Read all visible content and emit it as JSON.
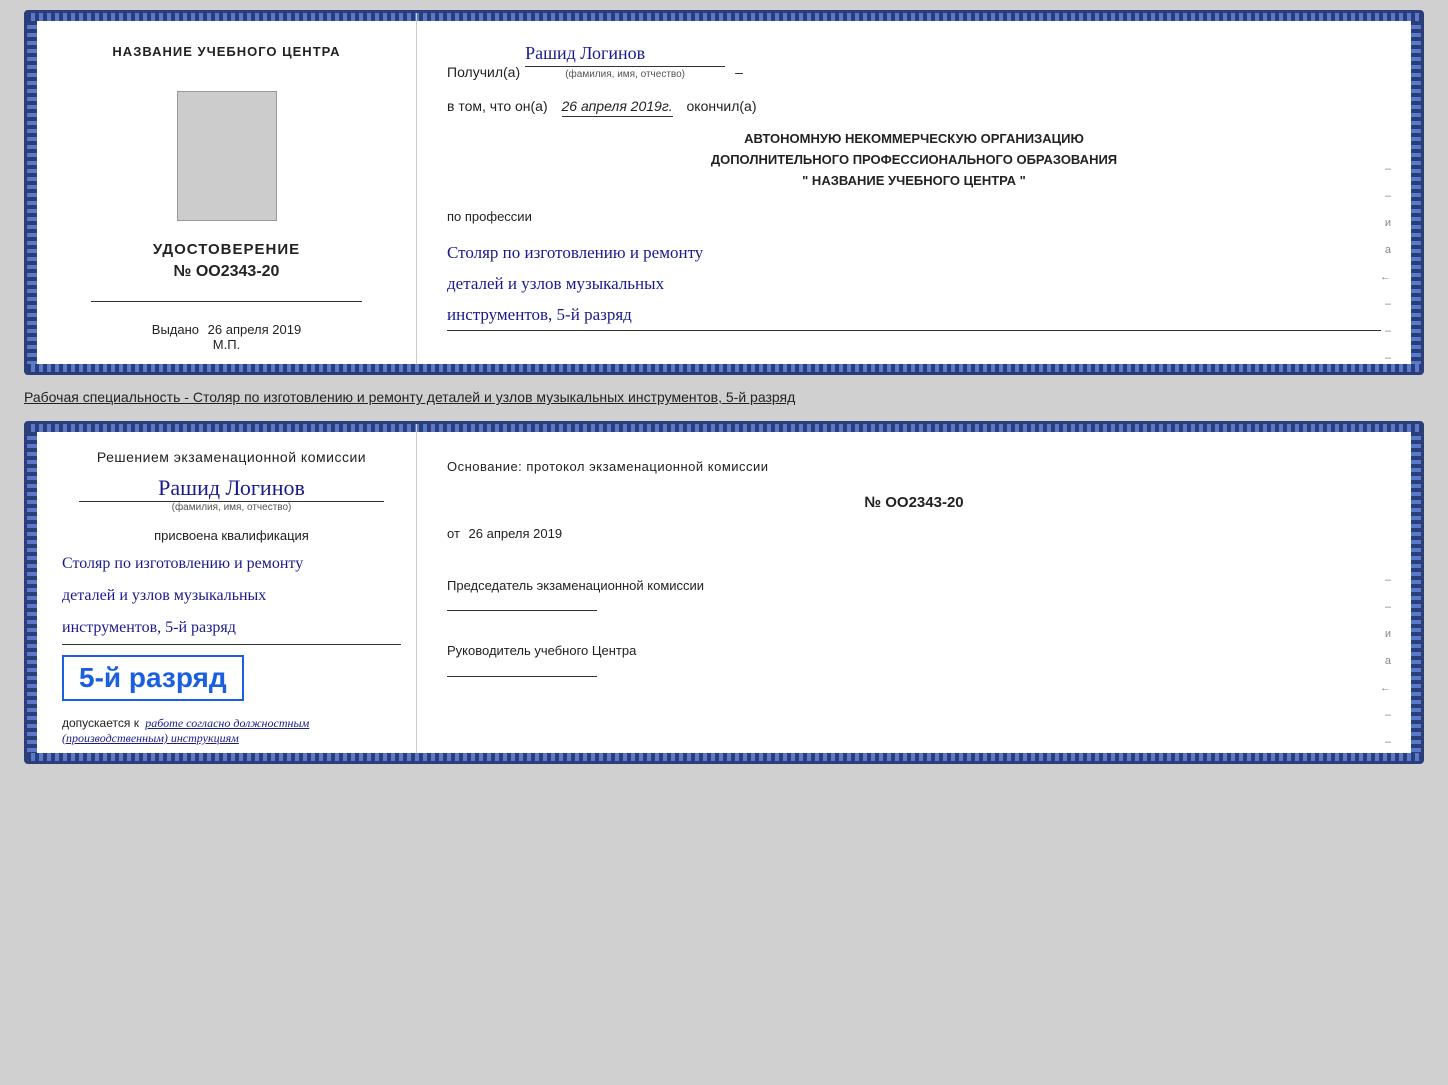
{
  "top_card": {
    "left": {
      "title": "НАЗВАНИЕ УЧЕБНОГО ЦЕНТРА",
      "cert_heading": "УДОСТОВЕРЕНИЕ",
      "cert_number": "№ OO2343-20",
      "issued_label": "Выдано",
      "issued_date": "26 апреля 2019",
      "mp_label": "М.П."
    },
    "right": {
      "received_label": "Получил(а)",
      "recipient_name": "Рашид Логинов",
      "fio_sub": "(фамилия, имя, отчество)",
      "in_that_label": "в том, что он(а)",
      "date_value": "26 апреля 2019г.",
      "finished_label": "окончил(а)",
      "institution_line1": "АВТОНОМНУЮ НЕКОММЕРЧЕСКУЮ ОРГАНИЗАЦИЮ",
      "institution_line2": "ДОПОЛНИТЕЛЬНОГО ПРОФЕССИОНАЛЬНОГО ОБРАЗОВАНИЯ",
      "institution_line3": "\"   НАЗВАНИЕ УЧЕБНОГО ЦЕНТРА   \"",
      "profession_label": "по профессии",
      "profession_line1": "Столяр по изготовлению и ремонту",
      "profession_line2": "деталей и узлов музыкальных",
      "profession_line3": "инструментов, 5-й разряд"
    }
  },
  "specialty_text": "Рабочая специальность - Столяр по изготовлению и ремонту деталей и узлов музыкальных инструментов, 5-й разряд",
  "bottom_card": {
    "left": {
      "decision_text": "Решением экзаменационной комиссии",
      "person_name": "Рашид Логинов",
      "fio_sub": "(фамилия, имя, отчество)",
      "qualification_label": "присвоена квалификация",
      "qual_line1": "Столяр по изготовлению и ремонту",
      "qual_line2": "деталей и узлов музыкальных",
      "qual_line3": "инструментов, 5-й разряд",
      "rank_badge": "5-й разряд",
      "допускается_label": "допускается к",
      "допускается_value": "работе согласно должностным (производственным) инструкциям"
    },
    "right": {
      "basis_text": "Основание: протокол экзаменационной комиссии",
      "proto_number": "№ OO2343-20",
      "date_prefix": "от",
      "date_value": "26 апреля 2019",
      "chairman_label": "Председатель экзаменационной комиссии",
      "director_label": "Руководитель учебного Центра"
    }
  },
  "edge_marks": {
    "top_right": [
      "–",
      "–",
      "и",
      "а",
      "←",
      "–",
      "–",
      "–",
      "–"
    ],
    "bottom_right": [
      "–",
      "–",
      "и",
      "а",
      "←",
      "–",
      "–",
      "–",
      "–"
    ]
  }
}
